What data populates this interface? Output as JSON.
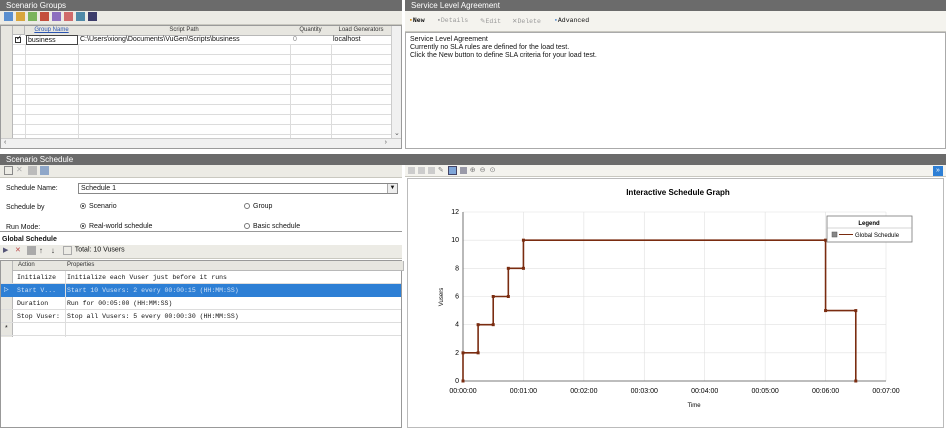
{
  "scenario_groups": {
    "title": "Scenario Groups",
    "columns": [
      "Group Name",
      "Script Path",
      "Quantity",
      "Load Generators"
    ],
    "rows": [
      {
        "checked": true,
        "group": "business",
        "path": "C:\\Users\\xiong\\Documents\\VuGen\\Scripts\\business",
        "quantity": "0",
        "generator": "localhost"
      }
    ]
  },
  "sla": {
    "title": "Service Level Agreement",
    "toolbar": {
      "new": "New",
      "details": "Details",
      "edit": "Edit",
      "delete": "Delete",
      "advanced": "Advanced"
    },
    "heading": "Service Level Agreement",
    "line1": "Currently no SLA rules are defined for the load test.",
    "line2": "Click the New button to define SLA criteria for your load test."
  },
  "schedule": {
    "title": "Scenario Schedule",
    "name_label": "Schedule Name:",
    "name_value": "Schedule 1",
    "by_label": "Schedule by",
    "by_opt1": "Scenario",
    "by_opt2": "Group",
    "mode_label": "Run Mode:",
    "mode_opt1": "Real-world schedule",
    "mode_opt2": "Basic schedule",
    "global_title": "Global Schedule",
    "total": "Total: 10 Vusers",
    "col_action": "Action",
    "col_props": "Properties",
    "actions": [
      {
        "action": "Initialize",
        "props": "Initialize each Vuser just before it runs"
      },
      {
        "action": "Start  V...",
        "props": "Start 10 Vusers: 2 every 00:00:15 (HH:MM:SS)"
      },
      {
        "action": "Duration",
        "props": "Run for 00:05:00 (HH:MM:SS)"
      },
      {
        "action": "Stop Vuser:",
        "props": "Stop all Vusers: 5 every 00:00:30 (HH:MM:SS)"
      }
    ],
    "new_row_marker": "*"
  },
  "graph": {
    "title": "Interactive Schedule Graph",
    "legend_title": "Legend",
    "legend_item": "Global Schedule",
    "xlabel": "Time",
    "ylabel": "Vusers",
    "xticks": [
      "00:00:00",
      "00:01:00",
      "00:02:00",
      "00:03:00",
      "00:04:00",
      "00:05:00",
      "00:06:00",
      "00:07:00"
    ],
    "yticks": [
      "0",
      "2",
      "4",
      "6",
      "8",
      "10",
      "12"
    ]
  },
  "chart_data": {
    "type": "line",
    "title": "Interactive Schedule Graph",
    "xlabel": "Time",
    "ylabel": "Vusers",
    "ylim": [
      0,
      12
    ],
    "xlim_seconds": [
      0,
      420
    ],
    "x_tick_labels": [
      "00:00:00",
      "00:01:00",
      "00:02:00",
      "00:03:00",
      "00:04:00",
      "00:05:00",
      "00:06:00",
      "00:07:00"
    ],
    "series": [
      {
        "name": "Global Schedule",
        "color": "#7a2c10",
        "x_seconds": [
          0,
          0,
          15,
          15,
          30,
          30,
          45,
          45,
          60,
          60,
          360,
          360,
          390,
          390
        ],
        "y": [
          0,
          2,
          2,
          4,
          4,
          6,
          6,
          8,
          8,
          10,
          10,
          5,
          5,
          0
        ]
      }
    ],
    "legend_position": "top-right",
    "grid": true
  }
}
